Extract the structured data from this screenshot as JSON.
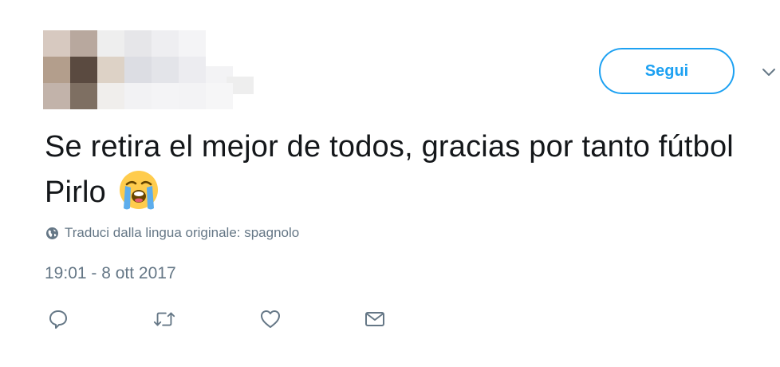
{
  "header": {
    "follow_label": "Segui"
  },
  "tweet": {
    "text": "Se retira el mejor de todos, gracias por tanto fútbol Pirlo",
    "emoji_name": "loudly-crying-face",
    "translate_label": "Traduci dalla lingua originale: spagnolo",
    "timestamp": "19:01 - 8 ott 2017"
  },
  "actions": {
    "icons": [
      "reply-icon",
      "retweet-icon",
      "like-icon",
      "direct-message-icon"
    ]
  },
  "colors": {
    "accent": "#1da1f2",
    "text": "#14171a",
    "secondary": "#657786"
  }
}
